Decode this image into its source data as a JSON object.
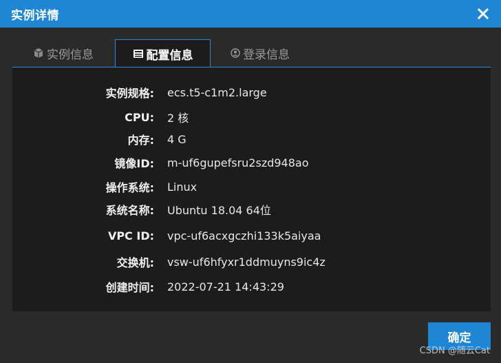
{
  "dialog": {
    "title": "实例详情",
    "close_icon": "close-icon"
  },
  "tabs": [
    {
      "label": "实例信息",
      "icon": "cube-icon",
      "active": false
    },
    {
      "label": "配置信息",
      "icon": "config-icon",
      "active": true
    },
    {
      "label": "登录信息",
      "icon": "user-icon",
      "active": false
    }
  ],
  "details": [
    {
      "label": "实例规格:",
      "value": "ecs.t5-c1m2.large"
    },
    {
      "label": "CPU:",
      "value": "2 核"
    },
    {
      "label": "内存:",
      "value": "4 G"
    },
    {
      "label": "镜像ID:",
      "value": "m-uf6gupefsru2szd948ao"
    },
    {
      "label": "操作系统:",
      "value": "Linux"
    },
    {
      "label": "系统名称:",
      "value": "Ubuntu 18.04 64位"
    },
    {
      "label": "VPC ID:",
      "value": "vpc-uf6acxgczhi133k5aiyaa"
    },
    {
      "label": "交换机:",
      "value": "vsw-uf6hfyxr1ddmuyns9ic4z"
    },
    {
      "label": "创建时间:",
      "value": "2022-07-21 14:43:29"
    }
  ],
  "footer": {
    "ok_label": "确定"
  },
  "watermark": "CSDN @随云Cat",
  "colors": {
    "accent": "#1f86d6",
    "background": "#2a2a2a",
    "panel": "#1c1c1c"
  }
}
